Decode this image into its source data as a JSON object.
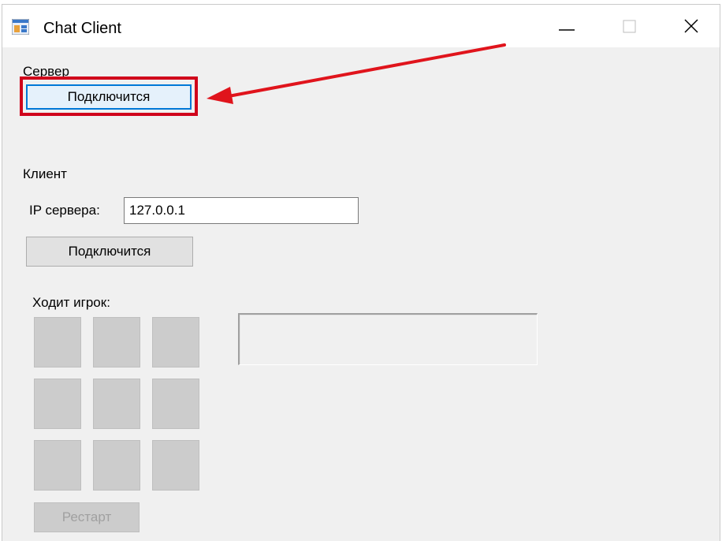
{
  "window": {
    "title": "Chat Client",
    "controls": [
      "minimize-icon",
      "maximize-icon",
      "close-icon"
    ]
  },
  "server_section": {
    "label": "Сервер",
    "connect_button": "Подключится"
  },
  "client_section": {
    "label": "Клиент",
    "ip_label": "IP сервера:",
    "ip_value": "127.0.0.1",
    "connect_button": "Подключится"
  },
  "game": {
    "turn_label": "Ходит игрок:",
    "board": [
      "",
      "",
      "",
      "",
      "",
      "",
      "",
      "",
      ""
    ],
    "restart_button": "Рестарт",
    "status_text": ""
  },
  "annotation": {
    "color": "#d0021b",
    "target": "server_section.connect_button"
  }
}
